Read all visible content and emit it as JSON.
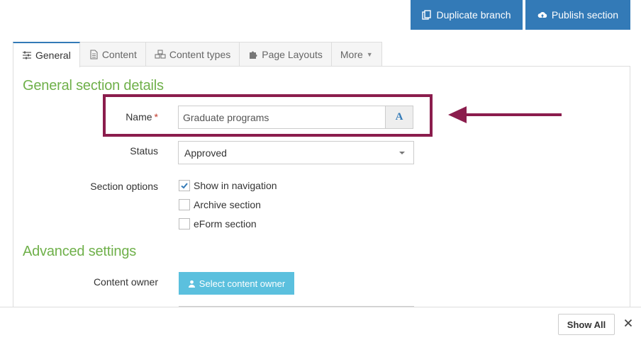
{
  "toolbar": {
    "duplicate_label": "Duplicate branch",
    "publish_label": "Publish section"
  },
  "tabs": [
    {
      "label": "General",
      "icon": "sliders-icon",
      "active": true
    },
    {
      "label": "Content",
      "icon": "document-icon",
      "active": false
    },
    {
      "label": "Content types",
      "icon": "cubes-icon",
      "active": false
    },
    {
      "label": "Page Layouts",
      "icon": "puzzle-icon",
      "active": false
    },
    {
      "label": "More",
      "icon": "caret-down-icon",
      "active": false
    }
  ],
  "general": {
    "title": "General section details",
    "name_label": "Name",
    "required_mark": "*",
    "name_value": "Graduate programs",
    "name_addon": "A",
    "status_label": "Status",
    "status_value": "Approved",
    "section_options_label": "Section options",
    "options": [
      {
        "label": "Show in navigation",
        "checked": true
      },
      {
        "label": "Archive section",
        "checked": false
      },
      {
        "label": "eForm section",
        "checked": false
      }
    ]
  },
  "advanced": {
    "title": "Advanced settings",
    "owner_label": "Content owner",
    "owner_button": "Select content owner"
  },
  "bottom": {
    "show_all_label": "Show All"
  },
  "colors": {
    "primary": "#337ab7",
    "info": "#5bc0de",
    "heading_green": "#6fb04a",
    "highlight": "#8b1d4d",
    "required": "#c0392b"
  }
}
